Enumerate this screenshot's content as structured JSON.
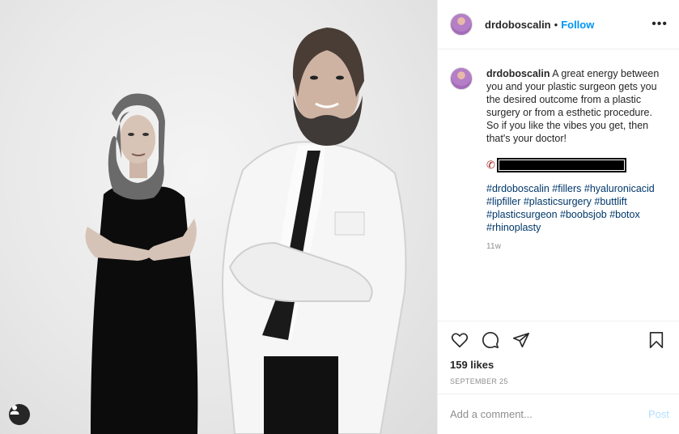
{
  "header": {
    "username": "drdoboscalin",
    "separator": "•",
    "follow_label": "Follow",
    "more_label": "•••"
  },
  "caption": {
    "username": "drdoboscalin",
    "text": "A great energy between you and your plastic surgeon gets you the desired outcome from a plastic surgery or from a esthetic procedure. So if you like the vibes you get, then that's your doctor!",
    "phone_icon": "phone-icon",
    "hashtags": "#drdoboscalin #fillers #hyaluronicacid #lipfiller #plasticsurgery #buttlift #plasticsurgeon #boobsjob #botox #rhinoplasty",
    "time": "11w"
  },
  "actions": {
    "icons": [
      "heart-icon",
      "comment-icon",
      "share-icon",
      "bookmark-icon"
    ],
    "likes": "159 likes",
    "date": "SEPTEMBER 25"
  },
  "comment_box": {
    "placeholder": "Add a comment...",
    "post_label": "Post"
  },
  "photo": {
    "user_tag_icon": "person-icon"
  }
}
